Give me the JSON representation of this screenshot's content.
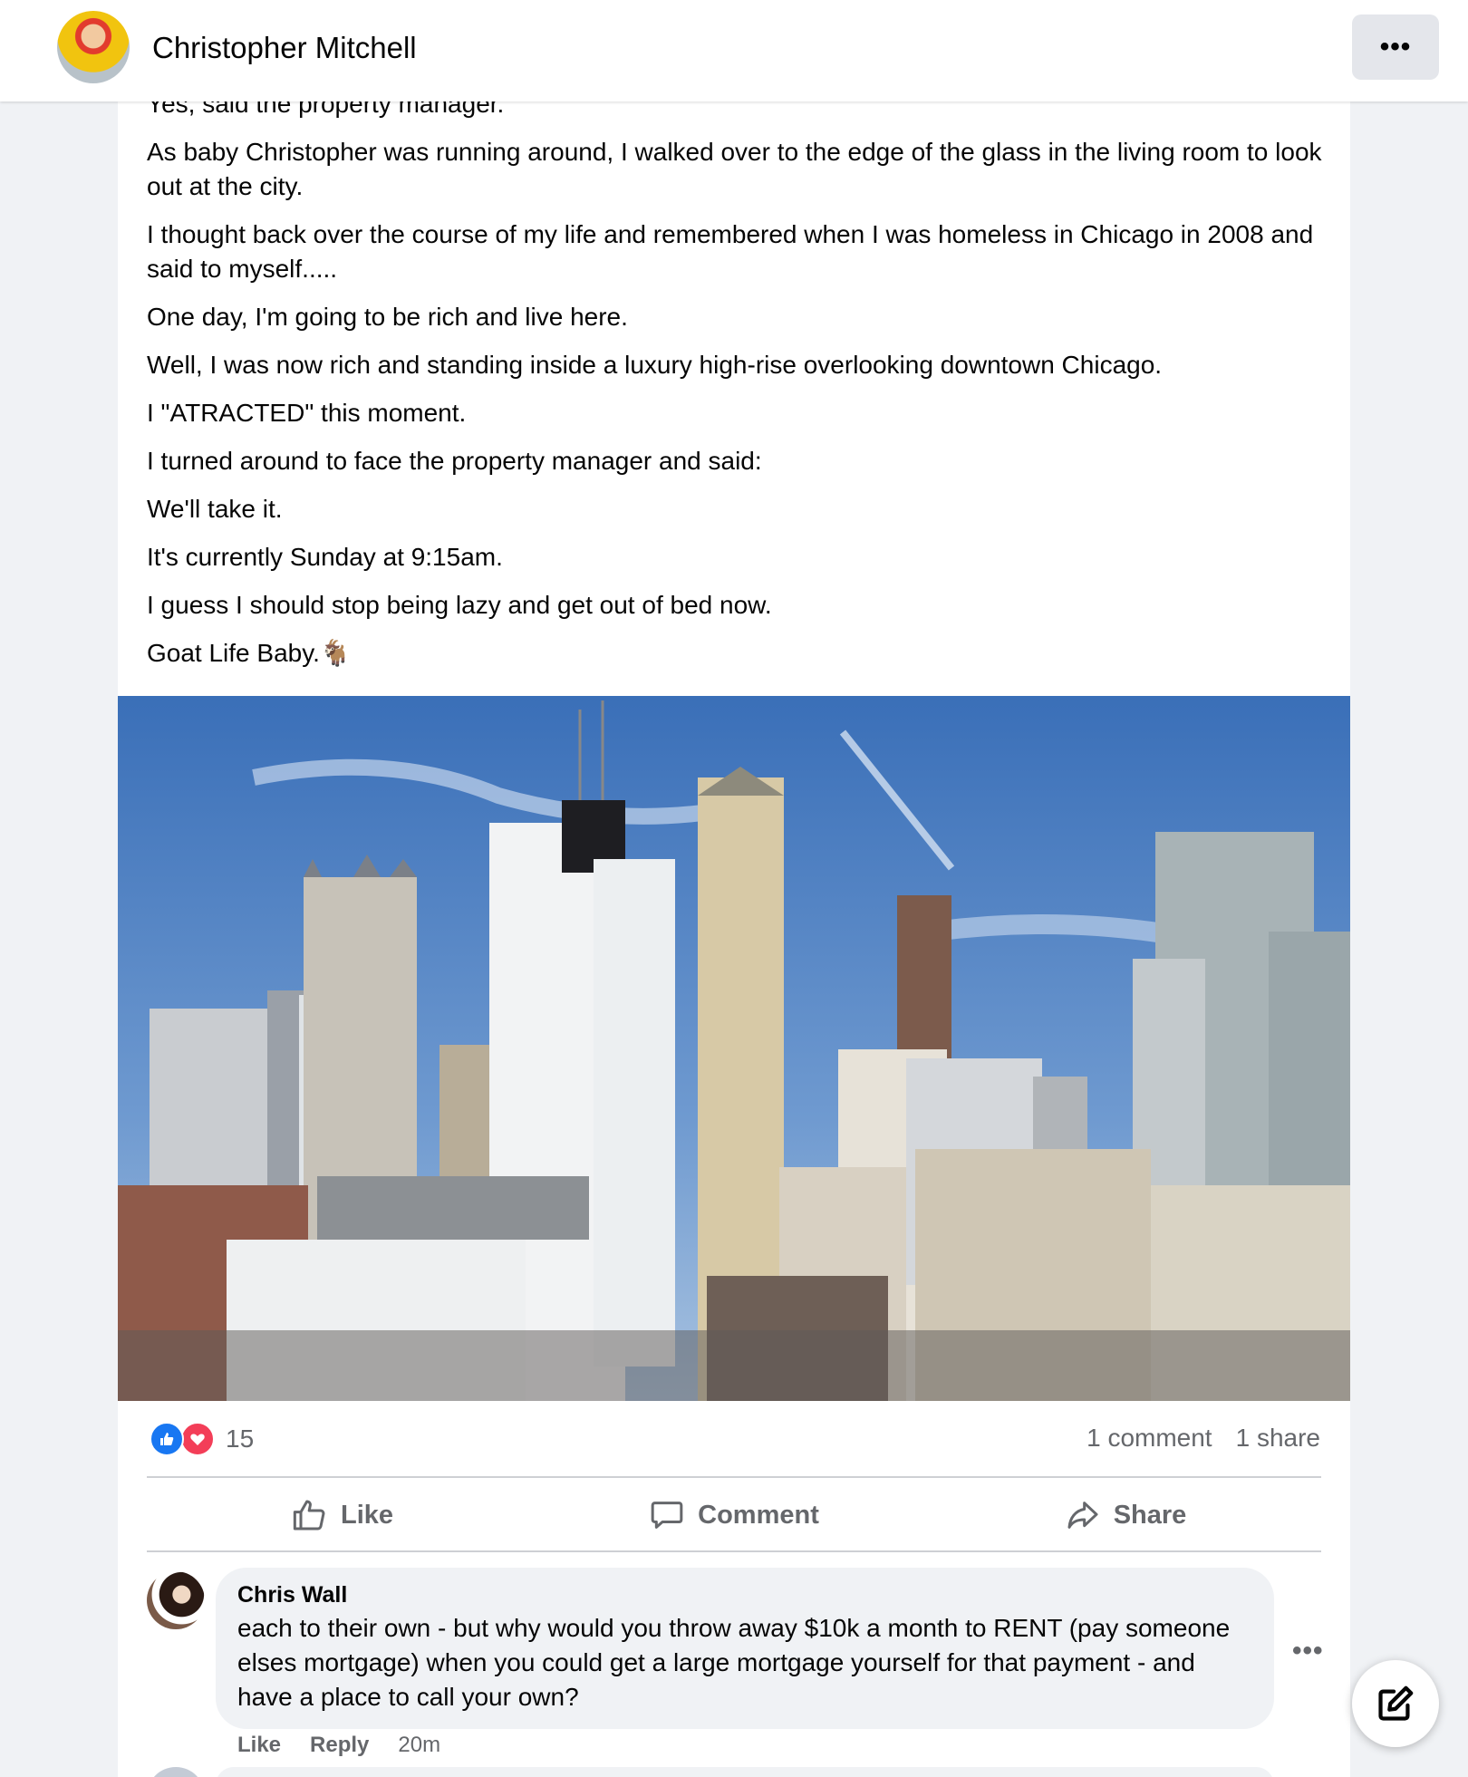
{
  "header": {
    "author_name": "Christopher Mitchell",
    "more_label": "•••"
  },
  "post": {
    "paragraphs": [
      "Yes, said the property manager.",
      "As baby Christopher was running around, I walked over to the edge of the glass in the living room to look out at the city.",
      "I thought back over the course of my life and remembered when I was homeless in Chicago in 2008 and said to myself.....",
      "One day, I'm going to be rich and live here.",
      "Well, I was now rich and standing inside a luxury high-rise overlooking downtown Chicago.",
      "I \"ATRACTED\" this moment.",
      "I turned around to face the property manager and said:",
      "We'll take it.",
      "It's currently Sunday at 9:15am.",
      "I guess I should stop being lazy and get out of bed now.",
      "Goat Life Baby.🐐"
    ]
  },
  "stats": {
    "reaction_count": "15",
    "comments": "1 comment",
    "shares": "1 share"
  },
  "actions": {
    "like": "Like",
    "comment": "Comment",
    "share": "Share"
  },
  "comment": {
    "author": "Chris Wall",
    "body": "each to their own - but why would you throw away $10k a month to RENT (pay someone elses mortgage) when you could get a large mortgage yourself for that payment - and have a place to call your own?",
    "like": "Like",
    "reply": "Reply",
    "time": "20m",
    "more_label": "•••"
  },
  "colors": {
    "like_blue": "#1877f2",
    "love_red": "#f33e58",
    "secondary_text": "#65676b"
  },
  "icons": [
    "like-reaction-icon",
    "love-reaction-icon",
    "thumbs-up-icon",
    "comment-bubble-icon",
    "share-arrow-icon",
    "compose-icon",
    "more-dots-icon"
  ]
}
